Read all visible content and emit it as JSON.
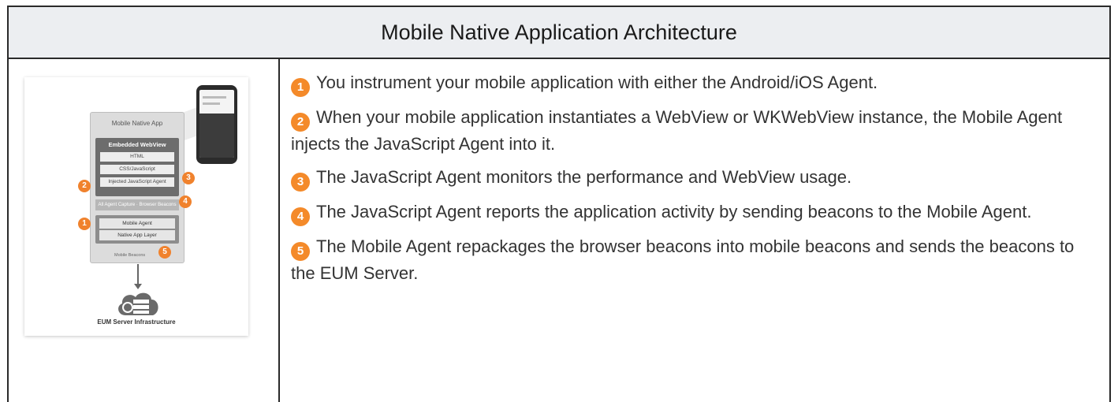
{
  "header": {
    "title": "Mobile Native Application Architecture"
  },
  "diagram": {
    "app_title": "Mobile Native App",
    "webview_title": "Embedded WebView",
    "webview_rows": [
      "HTML",
      "CSS/JavaScript",
      "Injected JavaScript Agent"
    ],
    "capture_label": "All Agent Capture · Browser Beacons",
    "agent_rows": [
      "Mobile Agent",
      "Native App Layer"
    ],
    "arrow_label": "Mobile Beacons",
    "eum_label": "EUM Server Infrastructure",
    "markers": [
      "1",
      "2",
      "3",
      "4",
      "5"
    ],
    "marker_color": "#f0822d"
  },
  "steps": [
    {
      "num": "1",
      "text": "You instrument your mobile application with either the Android/iOS Agent."
    },
    {
      "num": "2",
      "text": "When your mobile application instantiates a WebView or WKWebView instance, the Mobile Agent injects the JavaScript Agent into it."
    },
    {
      "num": "3",
      "text": "The JavaScript Agent monitors the performance and WebView usage."
    },
    {
      "num": "4",
      "text": "The JavaScript Agent reports the application activity by sending beacons to the Mobile Agent."
    },
    {
      "num": "5",
      "text": "The Mobile Agent repackages the browser beacons into mobile beacons and sends the beacons to the EUM Server."
    }
  ]
}
